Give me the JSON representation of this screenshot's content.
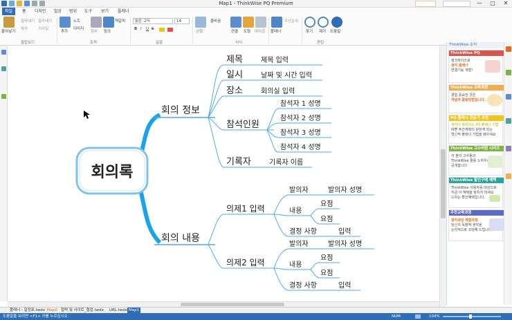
{
  "window": {
    "title": "Map1 - ThinkWise PQ Premium",
    "controls": [
      "—",
      "□",
      "✕"
    ]
  },
  "ribbon": {
    "tabs": [
      "파일",
      "홈",
      "디자인",
      "발상",
      "범위",
      "도구",
      "보기",
      "플래너"
    ],
    "active_tab": "홈",
    "groups": {
      "clipboard": {
        "paste": "붙여넣기",
        "cut": "잘라내기",
        "copy": "복사",
        "format_copy": "스타일",
        "label": "클립보드"
      },
      "topic": {
        "add": "추가",
        "note": "노트",
        "image": "이미지",
        "insert": "첨부",
        "hyperlink": "링크",
        "bookmark": "책갈피",
        "label": "토픽"
      },
      "font": {
        "name": "맑은 고딕",
        "size": "14",
        "bold": "B",
        "italic": "I",
        "underline": "U",
        "strike": "S",
        "label": "글꼴"
      },
      "style": {
        "balance": "균형",
        "wrap": "줄바꿈",
        "connect": "연결",
        "boundary": "도형",
        "label": "서식"
      },
      "format": {
        "label": "서식",
        "shape": "모양",
        "icon": "아이콘"
      },
      "planner": {
        "task": "플래너",
        "priority": "우선순위"
      },
      "edit": {
        "find": "찾기",
        "clear": "제거",
        "help": "도움말",
        "label": "편집"
      }
    }
  },
  "mindmap": {
    "central": "회의록",
    "main_topics": [
      {
        "label": "회의 정보",
        "children": [
          {
            "label": "제목",
            "children": [
              {
                "label": "제목 입력"
              }
            ]
          },
          {
            "label": "일시",
            "children": [
              {
                "label": "날짜 및 시간 입력"
              }
            ]
          },
          {
            "label": "장소",
            "children": [
              {
                "label": "회의실 입력"
              }
            ]
          },
          {
            "label": "참석인원",
            "children": [
              {
                "label": "참석자 1 성명"
              },
              {
                "label": "참석자 2 성명"
              },
              {
                "label": "참석자 3 성명"
              },
              {
                "label": "참석자 4 성명"
              }
            ]
          },
          {
            "label": "기록자",
            "children": [
              {
                "label": "기록자 이름"
              }
            ]
          }
        ]
      },
      {
        "label": "회의 내용",
        "children": [
          {
            "label": "의제1 입력",
            "children": [
              {
                "label": "발의자",
                "children": [
                  {
                    "label": "발의자 성명"
                  }
                ]
              },
              {
                "label": "내용",
                "children": [
                  {
                    "label": "요점"
                  },
                  {
                    "label": "요점"
                  }
                ]
              },
              {
                "label": "결정 사항",
                "children": [
                  {
                    "label": "입력"
                  }
                ]
              }
            ]
          },
          {
            "label": "의제2 입력",
            "children": [
              {
                "label": "발의자",
                "children": [
                  {
                    "label": "발의자 성명"
                  }
                ]
              },
              {
                "label": "내용",
                "children": [
                  {
                    "label": "요점"
                  },
                  {
                    "label": "요점"
                  }
                ]
              },
              {
                "label": "결정 사항",
                "children": [
                  {
                    "label": "입력"
                  }
                ]
              }
            ]
          }
        ]
      }
    ]
  },
  "right_panel": {
    "header": "ThinkWise 소식",
    "cards": [
      {
        "title": "ThinkWise PQ",
        "color": "#d9534f",
        "lines": [
          "씽크와이즈로",
          "생각 플래너",
          "연결기능 개발!"
        ],
        "emphasis": "생각 플래너"
      },
      {
        "title": "ThinkWise 교육과정",
        "color": "#f0ad4e",
        "lines": [
          "경험 중요한 것은",
          "개념과 활용방법입니다."
        ],
        "emphasis": "개념과 활용방법"
      },
      {
        "title": "PQ 플래너 전문가 과정",
        "color": "#f0c419",
        "lines": [
          "생각이 정리되는 PQ 플래너 기법",
          "바쁜 주간계획이 원하게 되는",
          "혁신적 플래너 기법을 배우세요"
        ],
        "emphasis": ""
      },
      {
        "title": "ThinkWise 고수비법 시리즈",
        "color": "#7cb342",
        "lines": [
          "각 분야 고수들의",
          "ThinkWise 활용 노하우를",
          "공개합니다."
        ],
        "emphasis": "활용 노하우"
      },
      {
        "title": "ThinkWise 할인구매 혜택",
        "color": "#26a69a",
        "lines": [
          "ThinkWise 사용자를 대상으로",
          "지금 이 혜택을 놓치지 마세요",
          "드리는 할인혜택입니다."
        ],
        "emphasis": "할인혜택"
      },
      {
        "title": "추천교육과정",
        "color": "#5c6bc0",
        "lines": [
          "생각코딩 체험과정",
          "당신의 독창적 생각을",
          "논리적으로 코딩해 드립니다."
        ],
        "emphasis": "생각코딩 체험과정"
      }
    ]
  },
  "document_tabs": [
    "플래너 - 일정표.twdx",
    "Map0",
    "협력 및 사이트_협업.twdx",
    "URL.twdx",
    "Map1"
  ],
  "active_document": "Map1",
  "status": {
    "left": "도움말을 보려면 <F1> 키를 누르십시오",
    "num": "NUM",
    "zoom": "104%"
  },
  "colors": {
    "accent": "#2f6db5",
    "branch_blue": "#1aa3e8",
    "line_blue": "#4fa9e8"
  }
}
